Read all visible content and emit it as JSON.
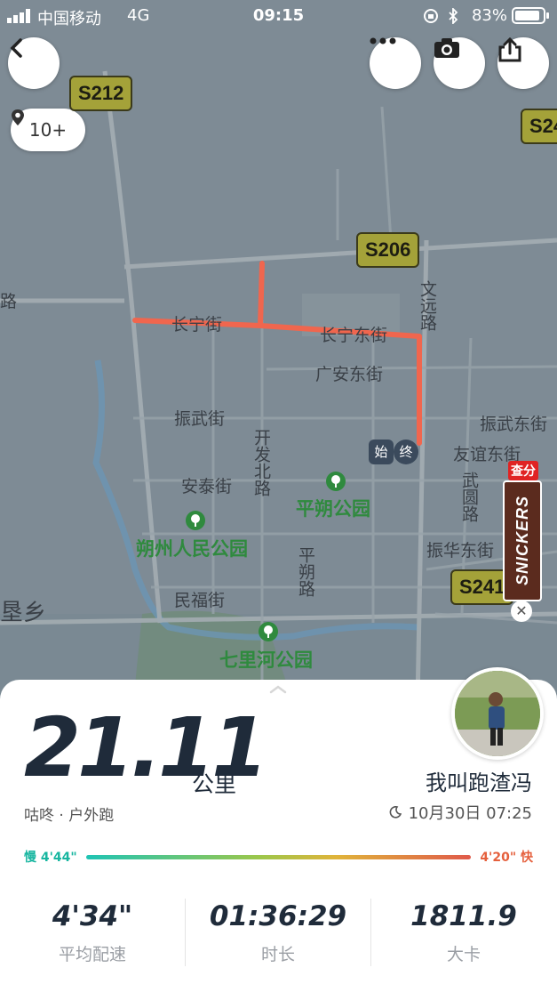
{
  "status_bar": {
    "carrier": "中国移动",
    "network": "4G",
    "time": "09:15",
    "battery": "83%"
  },
  "map": {
    "photo_count": "10+",
    "road_signs": [
      "S212",
      "S206",
      "S241",
      "S24"
    ],
    "streets": [
      "长宁街",
      "长宁东街",
      "广安东街",
      "振武街",
      "振武东街",
      "友谊东街",
      "安泰街",
      "开发北路",
      "文远路",
      "武圆路",
      "振华东街",
      "民福街",
      "平朔路",
      "路"
    ],
    "parks": [
      "平朔公园",
      "朔州人民公园",
      "七里河公园"
    ],
    "area_label": "垦乡",
    "start_marker": "始",
    "end_marker": "终",
    "ad_badge": "查分",
    "ad_brand": "SNICKERS"
  },
  "summary": {
    "distance": "21.11",
    "unit": "公里",
    "activity": "咕咚 · 户外跑",
    "username": "我叫跑渣冯",
    "datetime": "10月30日 07:25",
    "pace_slow": "慢 4'44\"",
    "pace_fast": "4'20\" 快",
    "stats": [
      {
        "value": "4'34\"",
        "label": "平均配速"
      },
      {
        "value": "01:36:29",
        "label": "时长"
      },
      {
        "value": "1811.9",
        "label": "大卡"
      }
    ]
  },
  "colors": {
    "route": "#f0664e",
    "map_bg": "#7e8b95",
    "text_dark": "#1f2b3a"
  }
}
